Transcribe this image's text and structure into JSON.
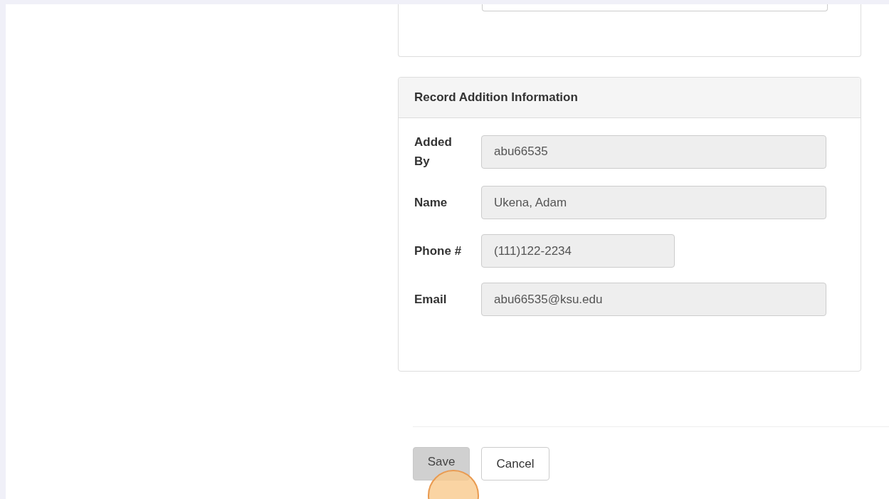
{
  "record_card": {
    "title": "Record Addition Information",
    "fields": [
      {
        "label": "Added By",
        "value": "abu66535",
        "kind": "wide"
      },
      {
        "label": "Name",
        "value": "Ukena, Adam",
        "kind": "wide"
      },
      {
        "label": "Phone #",
        "value": "(111)122-2234",
        "kind": "short"
      },
      {
        "label": "Email",
        "value": "abu66535@ksu.edu",
        "kind": "wide"
      }
    ]
  },
  "buttons": [
    {
      "label": "Save",
      "kind": "primary",
      "disabled": true
    },
    {
      "label": "Cancel",
      "kind": "default",
      "disabled": false
    }
  ]
}
